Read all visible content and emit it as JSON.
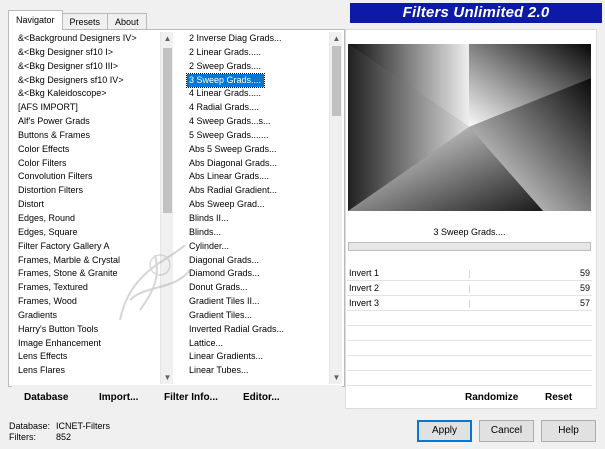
{
  "tabs": [
    {
      "label": "Navigator",
      "active": true
    },
    {
      "label": "Presets",
      "active": false
    },
    {
      "label": "About",
      "active": false
    }
  ],
  "title": "Filters Unlimited 2.0",
  "categories": [
    "&<Background Designers IV>",
    "&<Bkg Designer sf10 I>",
    "&<Bkg Designer sf10 III>",
    "&<Bkg Designers sf10 IV>",
    "&<Bkg Kaleidoscope>",
    "[AFS IMPORT]",
    "Alf's Power Grads",
    "Buttons & Frames",
    "Color Effects",
    "Color Filters",
    "Convolution Filters",
    "Distortion Filters",
    "Distort",
    "Edges, Round",
    "Edges, Square",
    "Filter Factory Gallery A",
    "Frames, Marble & Crystal",
    "Frames, Stone & Granite",
    "Frames, Textured",
    "Frames, Wood",
    "Gradients",
    "Harry's Button Tools",
    "Image Enhancement",
    "Lens Effects",
    "Lens Flares"
  ],
  "filters": [
    "2 Inverse Diag Grads...",
    "2 Linear Grads.....",
    "2 Sweep Grads....",
    "3 Sweep Grads....",
    "4 Linear Grads.....",
    "4 Radial Grads....",
    "4 Sweep Grads...s...",
    "5 Sweep Grads.......",
    "Abs 5 Sweep Grads...",
    "Abs Diagonal Grads...",
    "Abs Linear Grads....",
    "Abs Radial Gradient...",
    "Abs Sweep Grad...",
    "Blinds II...",
    "Blinds...",
    "Cylinder...",
    "Diagonal Grads...",
    "Diamond Grads...",
    "Donut Grads...",
    "Gradient Tiles II...",
    "Gradient Tiles...",
    "Inverted Radial Grads...",
    "Lattice...",
    "Linear Gradients...",
    "Linear Tubes..."
  ],
  "selected_filter_index": 3,
  "selected_category_index": 6,
  "left_buttons": [
    {
      "label": "Database",
      "name": "database-button"
    },
    {
      "label": "Import...",
      "name": "import-button"
    },
    {
      "label": "Filter Info...",
      "name": "filter-info-button"
    },
    {
      "label": "Editor...",
      "name": "editor-button"
    }
  ],
  "filter_name": "3 Sweep Grads....",
  "sliders": [
    {
      "label": "Invert 1",
      "value": "59"
    },
    {
      "label": "Invert 2",
      "value": "59"
    },
    {
      "label": "Invert 3",
      "value": "57"
    }
  ],
  "right_buttons": {
    "randomize": "Randomize",
    "reset": "Reset"
  },
  "info": {
    "database_key": "Database:",
    "database_value": "ICNET-Filters",
    "filters_key": "Filters:",
    "filters_value": "852"
  },
  "dialog_buttons": {
    "apply": "Apply",
    "cancel": "Cancel",
    "help": "Help"
  },
  "colors": {
    "title_bg": "#0d1aa8",
    "selection": "#0078d7"
  }
}
